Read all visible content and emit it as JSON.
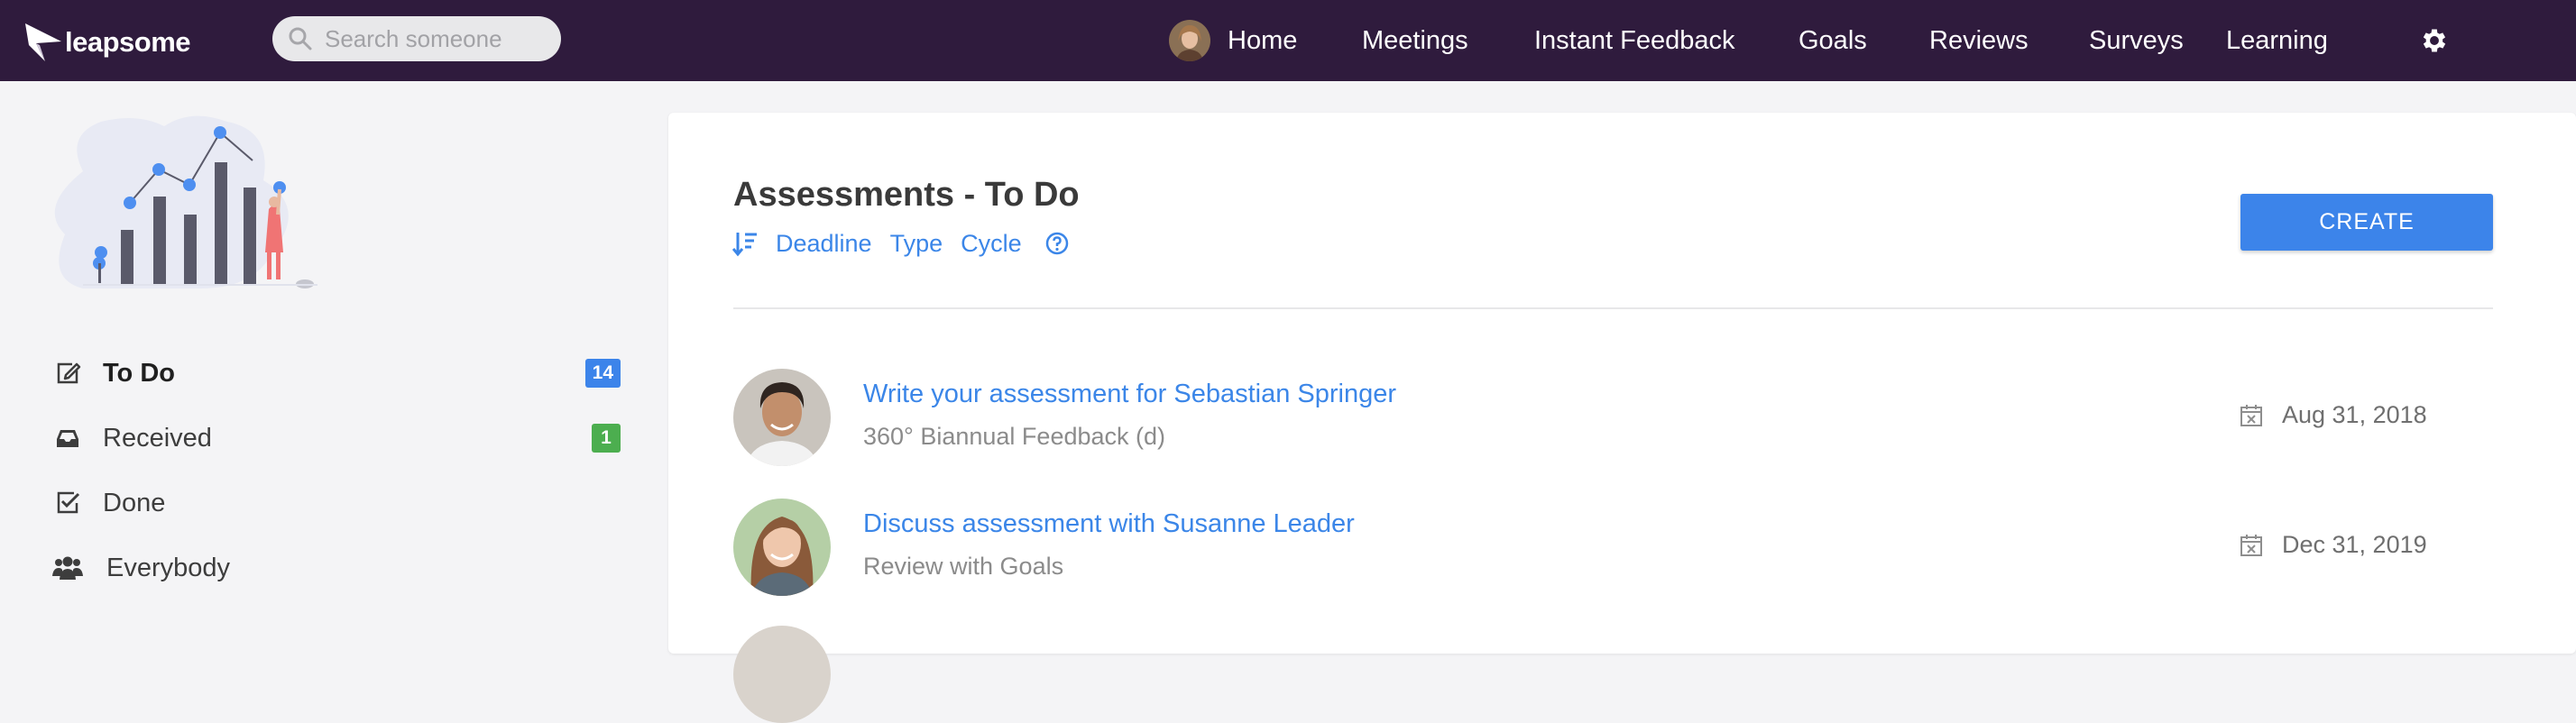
{
  "app": {
    "name": "leapsome"
  },
  "search": {
    "placeholder": "Search someone"
  },
  "nav": {
    "items": [
      {
        "label": "Home"
      },
      {
        "label": "Meetings"
      },
      {
        "label": "Instant Feedback"
      },
      {
        "label": "Goals"
      },
      {
        "label": "Reviews"
      },
      {
        "label": "Surveys"
      },
      {
        "label": "Learning"
      }
    ],
    "settings_icon": "gear-icon"
  },
  "sidebar": {
    "items": [
      {
        "label": "To Do",
        "icon": "edit-icon",
        "badge": "14",
        "badge_color": "#3c84ea",
        "active": true
      },
      {
        "label": "Received",
        "icon": "inbox-icon",
        "badge": "1",
        "badge_color": "#4cae4f"
      },
      {
        "label": "Done",
        "icon": "check-square-icon"
      },
      {
        "label": "Everybody",
        "icon": "users-icon"
      }
    ]
  },
  "main": {
    "title": "Assessments - To Do",
    "filters": [
      "Deadline",
      "Type",
      "Cycle"
    ],
    "create_label": "CREATE",
    "assessments": [
      {
        "title": "Write your assessment for Sebastian Springer",
        "subtitle": "360° Biannual Feedback (d)",
        "date": "Aug 31, 2018"
      },
      {
        "title": "Discuss assessment with Susanne Leader",
        "subtitle": "Review with Goals",
        "date": "Dec 31, 2019"
      }
    ]
  },
  "colors": {
    "topbar": "#2f1b3d",
    "accent": "#3c84ea",
    "success": "#4cae4f",
    "background": "#f4f4f6"
  }
}
